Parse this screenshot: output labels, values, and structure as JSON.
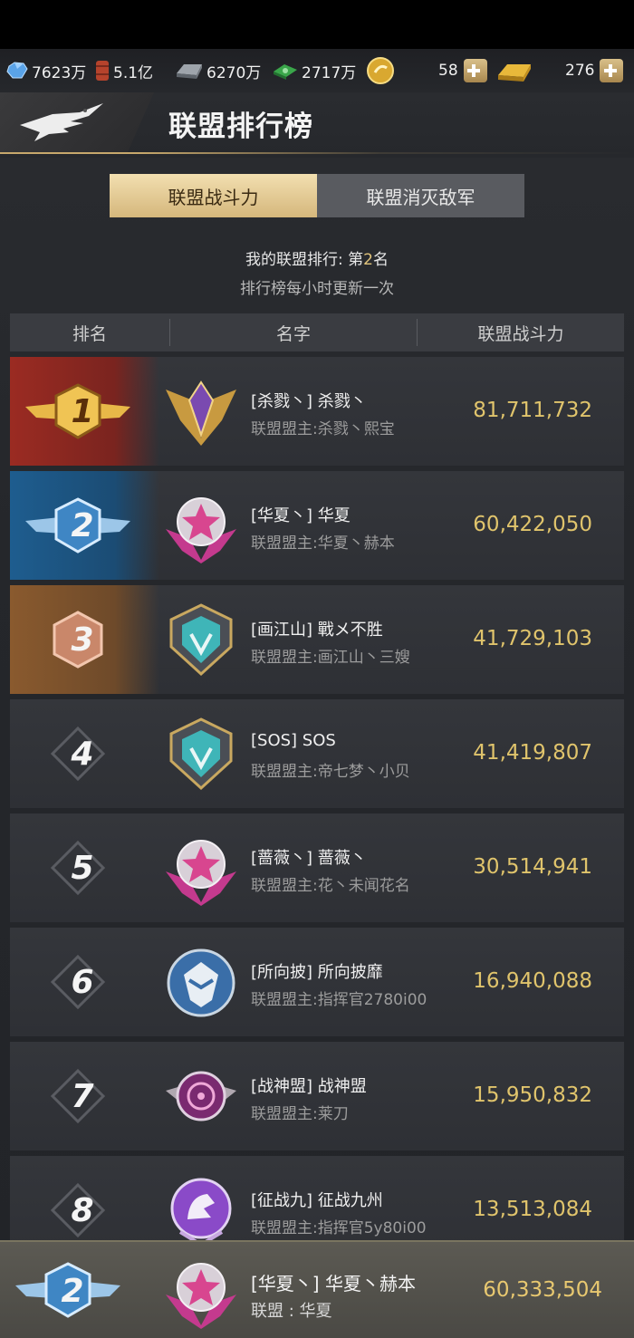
{
  "resources": {
    "crystal": "7623万",
    "oil": "5.1亿",
    "steel": "6270万",
    "cash": "2717万",
    "coin_count": "58",
    "gold_count": "276"
  },
  "header": {
    "title": "联盟排行榜"
  },
  "tabs": [
    {
      "label": "联盟战斗力",
      "active": true
    },
    {
      "label": "联盟消灭敌军",
      "active": false
    }
  ],
  "info": {
    "my_rank_prefix": "我的联盟排行: 第",
    "my_rank_num": "2",
    "my_rank_suffix": "名",
    "update_note": "排行榜每小时更新一次"
  },
  "columns": {
    "rank": "排名",
    "name": "名字",
    "power": "联盟战斗力"
  },
  "rows": [
    {
      "rank": "1",
      "name": "[杀戮丶] 杀戮丶",
      "leader": "联盟盟主:杀戮丶熙宝",
      "power": "81,711,732",
      "emblem": "gold-wings-emblem"
    },
    {
      "rank": "2",
      "name": "[华夏丶] 华夏",
      "leader": "联盟盟主:华夏丶赫本",
      "power": "60,422,050",
      "emblem": "pink-star-emblem"
    },
    {
      "rank": "3",
      "name": "[画江山] 戰メ不胜",
      "leader": "联盟盟主:画江山丶三嫂",
      "power": "41,729,103",
      "emblem": "teal-shield-emblem"
    },
    {
      "rank": "4",
      "name": "[SOS] SOS",
      "leader": "联盟盟主:帝七梦丶小贝",
      "power": "41,419,807",
      "emblem": "teal-shield-emblem"
    },
    {
      "rank": "5",
      "name": "[蔷薇丶] 蔷薇丶",
      "leader": "联盟盟主:花丶未闻花名",
      "power": "30,514,941",
      "emblem": "pink-star-emblem"
    },
    {
      "rank": "6",
      "name": "[所向披] 所向披靡",
      "leader": "联盟盟主:指挥官2780i00",
      "power": "16,940,088",
      "emblem": "blue-eagle-emblem"
    },
    {
      "rank": "7",
      "name": "[战神盟] 战神盟",
      "leader": "联盟盟主:莱刀",
      "power": "15,950,832",
      "emblem": "purple-target-emblem"
    },
    {
      "rank": "8",
      "name": "[征战九] 征战九州",
      "leader": "联盟盟主:指挥官5y80i00",
      "power": "13,513,084",
      "emblem": "purple-wolf-emblem"
    }
  ],
  "footer": {
    "rank": "2",
    "name": "[华夏丶] 华夏丶赫本",
    "alliance": "联盟 : 华夏",
    "power": "60,333,504"
  },
  "colors": {
    "gold_text": "#e0c46c",
    "tab_active": "#e8cf97",
    "rank1": "#9b2b22",
    "rank2": "#1e5d8f",
    "rank3": "#8a5a2e"
  }
}
